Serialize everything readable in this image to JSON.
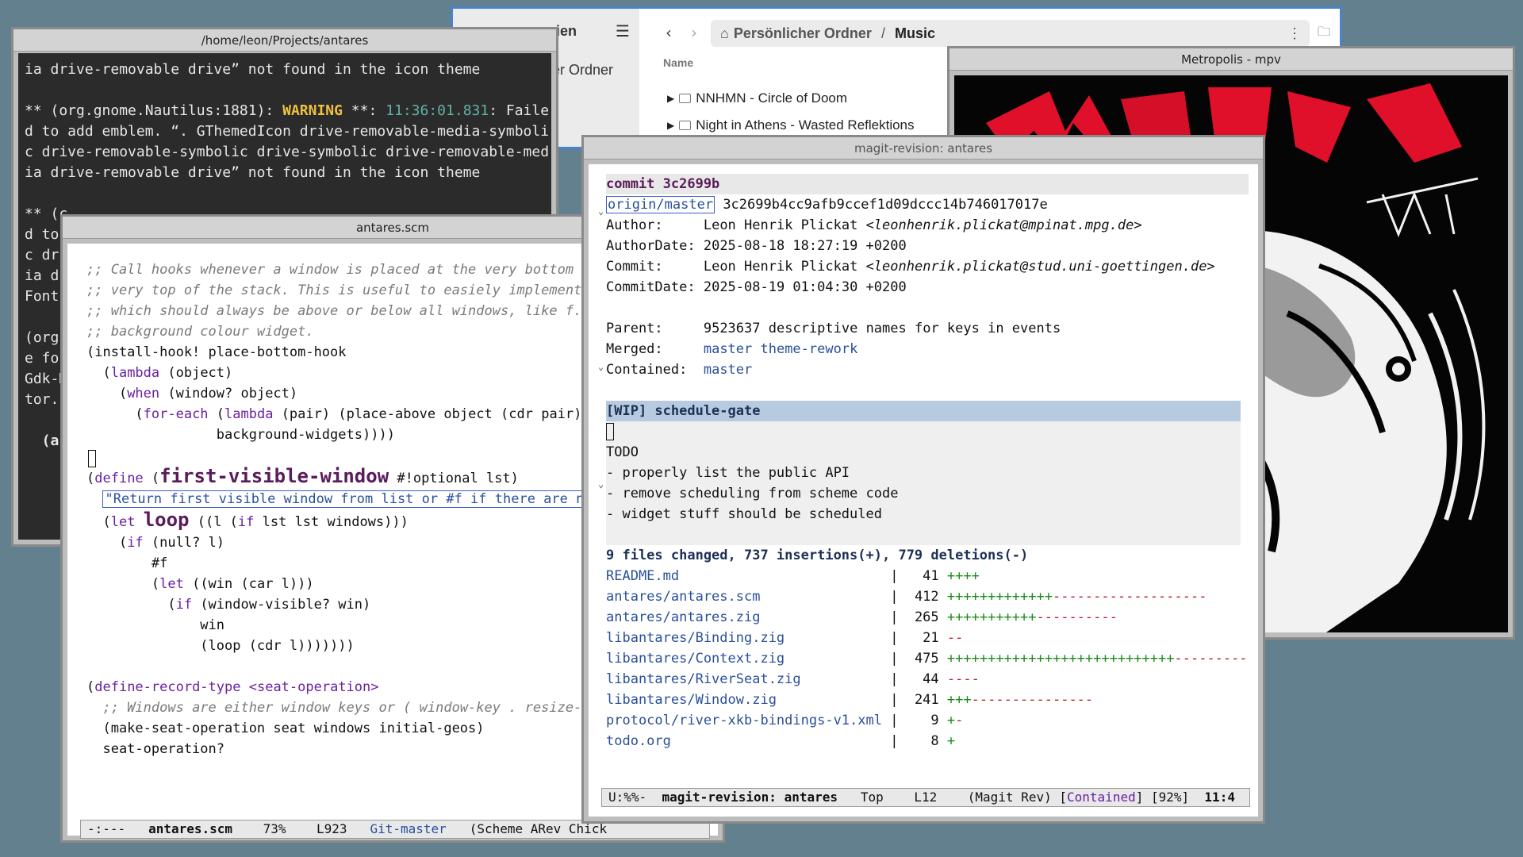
{
  "terminal": {
    "title": "/home/leon/Projects/antares",
    "lines": [
      {
        "t": "ia drive-removable drive” not found in the icon theme"
      },
      {
        "t": ""
      },
      {
        "t": "** (org.gnome.Nautilus:1881): ",
        "warn": "WARNING",
        "t2": " **: ",
        "ts": "11:36:01.831",
        "t3": ": Faile"
      },
      {
        "t": "d to add emblem. “. GThemedIcon drive-removable-media-symboli"
      },
      {
        "t": "c drive-removable-symbolic drive-symbolic drive-removable-med"
      },
      {
        "t": "ia drive-removable drive” not found in the icon theme"
      },
      {
        "t": ""
      },
      {
        "t": "** (c"
      },
      {
        "t": "d to "
      },
      {
        "t": "c dri"
      },
      {
        "t": "ia dri"
      },
      {
        "t": "Fontc"
      },
      {
        "t": ""
      },
      {
        "t": "(org."
      },
      {
        "t": "e for"
      },
      {
        "t": "Gdk-M"
      },
      {
        "t": "tor."
      },
      {
        "t": ""
      },
      {
        "t": "  (ar"
      }
    ]
  },
  "files": {
    "sidebar_title": "eien",
    "sidebar_item": "er Ordner",
    "path_home": "Persönlicher Ordner",
    "path_sep": "/",
    "path_current": "Music",
    "column_name": "Name",
    "rows": [
      "NNHMN - Circle of Doom",
      "Night in Athens - Wasted Reflektions"
    ]
  },
  "mpv": {
    "title": "Metropolis - mpv"
  },
  "scheme": {
    "title": "antares.scm",
    "modeline": {
      "state": "-:---",
      "buffer": "antares.scm",
      "percent": "73%",
      "line": "L923",
      "vc": "Git-master",
      "modes": "(Scheme ARev Chick"
    }
  },
  "magit": {
    "title": "magit-revision: antares",
    "commit_label": "commit 3c2699b",
    "ref": "origin/master",
    "full_hash": "3c2699b4cc9afb9ccef1d09dccc14b746017017e",
    "author_label": "Author:",
    "author": "Leon Henrik Plickat",
    "author_email": "<leonhenrik.plickat@mpinat.mpg.de>",
    "author_date_label": "AuthorDate:",
    "author_date": "2025-08-18 18:27:19 +0200",
    "committer_label": "Commit:",
    "committer": "Leon Henrik Plickat",
    "committer_email": "<leonhenrik.plickat@stud.uni-goettingen.de>",
    "commit_date_label": "CommitDate:",
    "commit_date": "2025-08-19 01:04:30 +0200",
    "parent_label": "Parent:",
    "parent_hash": "9523637",
    "parent_msg": "descriptive names for keys in events",
    "merged_label": "Merged:",
    "merged": "master theme-rework",
    "contained_label": "Contained:",
    "contained": "master",
    "summary": "[WIP] schedule-gate",
    "body": [
      "TODO",
      "- properly list the public API",
      "- remove scheduling from scheme code",
      "- widget stuff should be scheduled"
    ],
    "diffstat": "9 files changed, 737 insertions(+), 779 deletions(-)",
    "files": [
      {
        "name": "README.md",
        "n": "41",
        "plus": "++++",
        "minus": ""
      },
      {
        "name": "antares/antares.scm",
        "n": "412",
        "plus": "+++++++++++++",
        "minus": "-------------------"
      },
      {
        "name": "antares/antares.zig",
        "n": "265",
        "plus": "+++++++++++",
        "minus": "----------"
      },
      {
        "name": "libantares/Binding.zig",
        "n": "21",
        "plus": "",
        "minus": "--"
      },
      {
        "name": "libantares/Context.zig",
        "n": "475",
        "plus": "++++++++++++++++++++++++++++",
        "minus": "---------"
      },
      {
        "name": "libantares/RiverSeat.zig",
        "n": "44",
        "plus": "",
        "minus": "----"
      },
      {
        "name": "libantares/Window.zig",
        "n": "241",
        "plus": "+++",
        "minus": "---------------"
      },
      {
        "name": "protocol/river-xkb-bindings-v1.xml",
        "n": "9",
        "plus": "+",
        "minus": "-"
      },
      {
        "name": "todo.org",
        "n": "8",
        "plus": "+",
        "minus": ""
      }
    ],
    "modeline": {
      "state": "U:%%-",
      "buffer": "magit-revision: antares",
      "pos": "Top",
      "line": "L12",
      "mode": "(Magit Rev)",
      "contained": "Contained",
      "pct": "[92%]",
      "time": "11:4"
    }
  }
}
